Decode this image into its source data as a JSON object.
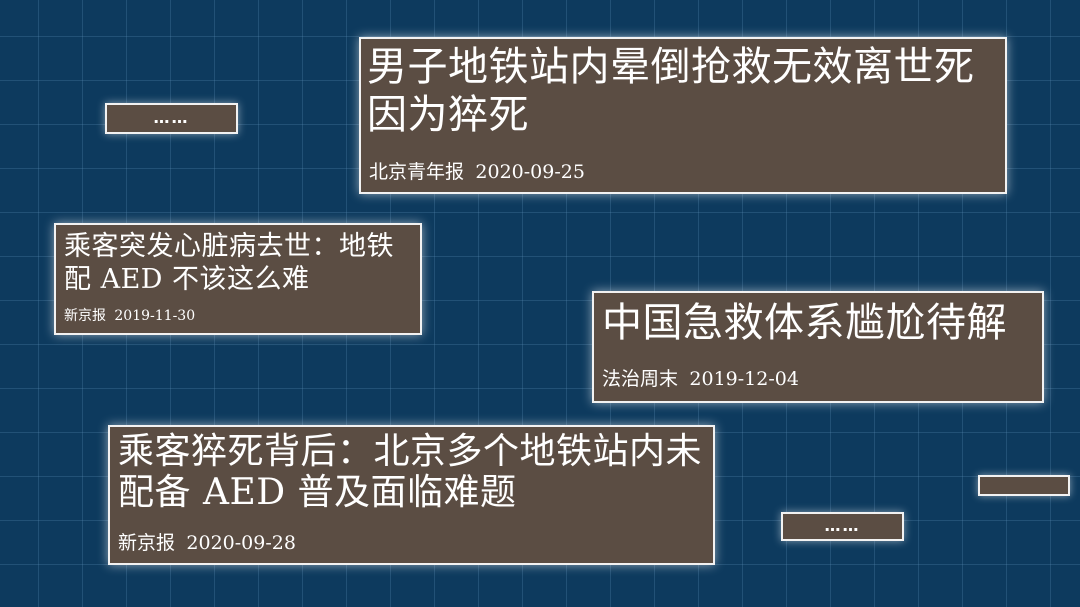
{
  "cards": [
    {
      "headline": "男子地铁站内晕倒抢救无效离世死因为猝死",
      "source": "北京青年报",
      "date": "2020-09-25"
    },
    {
      "headline": "乘客突发心脏病去世：地铁配 AED 不该这么难",
      "source": "新京报",
      "date": "2019-11-30"
    },
    {
      "headline": "中国急救体系尴尬待解",
      "source": "法治周末",
      "date": "2019-12-04"
    },
    {
      "headline": "乘客猝死背后：北京多个地铁站内未配备 AED  普及面临难题",
      "source": "新京报",
      "date": "2020-09-28"
    }
  ],
  "placeholders": [
    {
      "text": "……"
    },
    {
      "text": "……"
    },
    {
      "text": ""
    }
  ],
  "colors": {
    "background": "#0d3a5e",
    "card": "#5b4d43",
    "border": "#f2f2f2",
    "text": "#ffffff"
  }
}
